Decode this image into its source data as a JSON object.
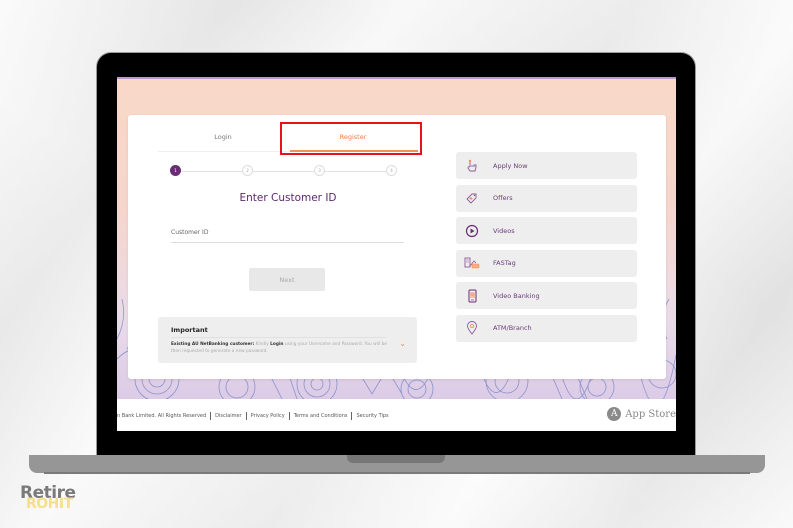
{
  "tabs": {
    "login": "Login",
    "register": "Register",
    "active": "Register"
  },
  "stepper": {
    "steps": [
      "1",
      "2",
      "3",
      "4"
    ],
    "current_step": 1
  },
  "form": {
    "heading": "Enter Customer ID",
    "customer_id_label": "Customer ID",
    "customer_id_value": "",
    "next_label": "Next"
  },
  "important": {
    "title": "Important",
    "bold_lead": "Existing AU NetBanking customer:",
    "text_1": " Kindly ",
    "bold_login": "Login",
    "text_2": " using your Username and Password. You will be then requested to generate a new password."
  },
  "side_menu": [
    {
      "label": "Apply Now",
      "icon": "hand-pointer-icon"
    },
    {
      "label": "Offers",
      "icon": "offer-tag-icon"
    },
    {
      "label": "Videos",
      "icon": "play-circle-icon"
    },
    {
      "label": "FASTag",
      "icon": "fastag-icon"
    },
    {
      "label": "Video Banking",
      "icon": "mobile-video-icon"
    },
    {
      "label": "ATM/Branch",
      "icon": "location-pin-icon"
    }
  ],
  "footer": {
    "copyright": "n Bank Limited. All Rights Reserved",
    "links": [
      "Disclaimer",
      "Privacy Policy",
      "Terms and Conditions",
      "Security Tips"
    ],
    "app_store": "App Store"
  },
  "watermark": {
    "line1": "Retire",
    "line2": "ROHIT"
  },
  "colors": {
    "brand_purple": "#6b2c77",
    "accent_orange": "#f07a3c",
    "highlight_red": "#e8121a"
  }
}
